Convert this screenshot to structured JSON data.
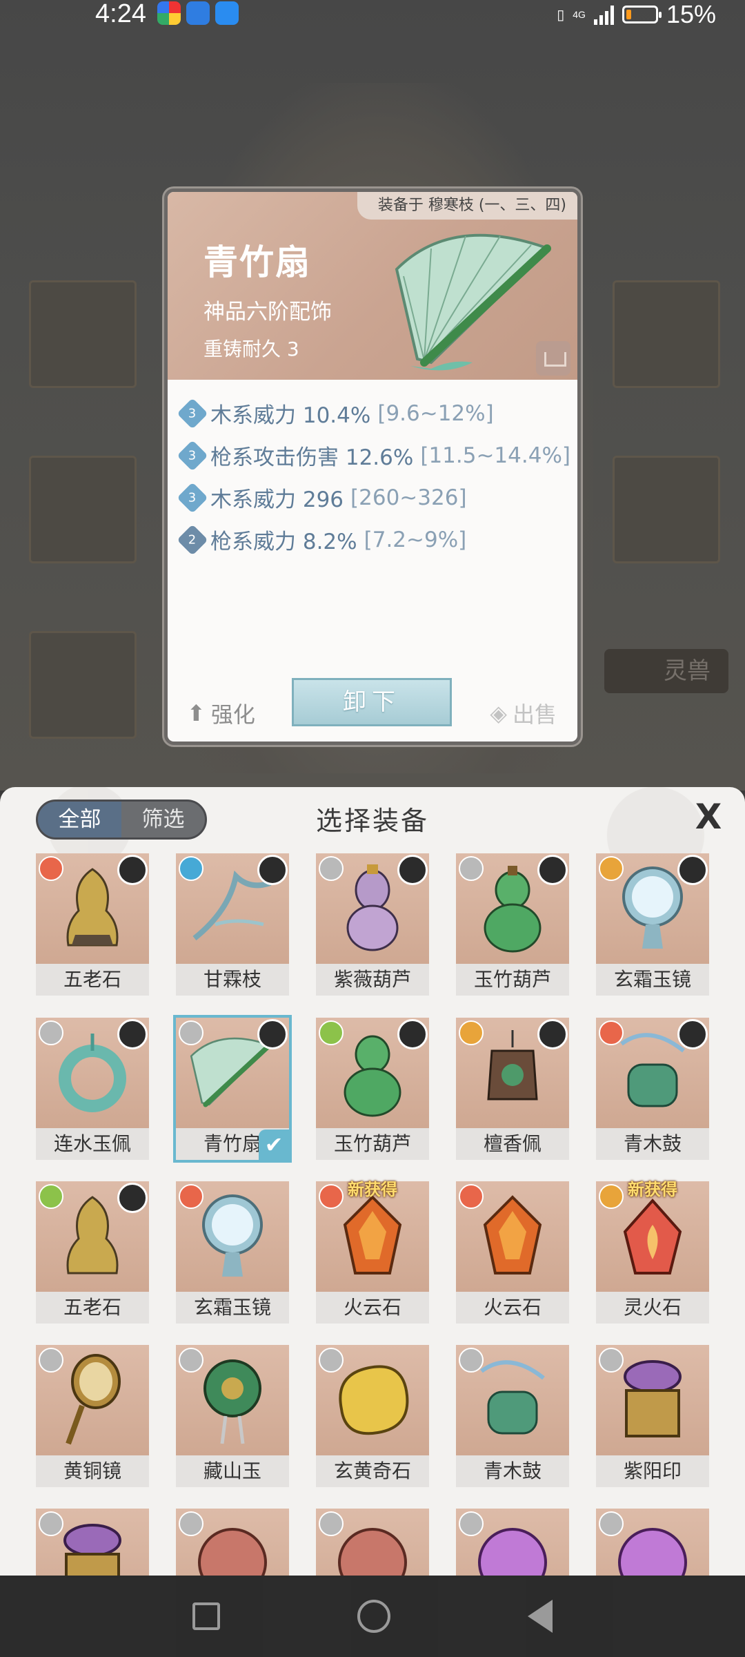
{
  "status_bar": {
    "time": "4:24",
    "network": "4G",
    "battery_pct": "15%",
    "battery_level": 0.15
  },
  "detail": {
    "equipped_on": "装备于 穆寒枝 (一、三、四)",
    "name": "青竹扇",
    "grade": "神品六阶配饰",
    "durability": "重铸耐久 3",
    "stats": [
      {
        "gem": "3",
        "text": "木系威力 10.4%",
        "range": "[9.6~12%]"
      },
      {
        "gem": "3",
        "text": "枪系攻击伤害 12.6%",
        "range": "[11.5~14.4%]"
      },
      {
        "gem": "3",
        "text": "木系威力 296",
        "range": "[260~326]"
      },
      {
        "gem": "2",
        "text": "枪系威力 8.2%",
        "range": "[7.2~9%]"
      }
    ],
    "enhance_label": "强化",
    "unequip_label": "卸下",
    "sell_label": "出售"
  },
  "sheet": {
    "tab_all": "全部",
    "tab_filter": "筛选",
    "title": "选择装备",
    "close": "X",
    "new_badge": "新获得",
    "items": [
      {
        "name": "五老石",
        "elem": "#e8664a",
        "owned": true
      },
      {
        "name": "甘霖枝",
        "elem": "#46a9d6",
        "owned": true
      },
      {
        "name": "紫薇葫芦",
        "elem": "#b9b9b9",
        "owned": true
      },
      {
        "name": "玉竹葫芦",
        "elem": "#b9b9b9",
        "owned": true
      },
      {
        "name": "玄霜玉镜",
        "elem": "#e8a43a",
        "owned": true
      },
      {
        "name": "连水玉佩",
        "elem": "#b9b9b9",
        "owned": true
      },
      {
        "name": "青竹扇",
        "elem": "#b9b9b9",
        "owned": true,
        "selected": true
      },
      {
        "name": "玉竹葫芦",
        "elem": "#8cc24a",
        "owned": true
      },
      {
        "name": "檀香佩",
        "elem": "#e8a43a",
        "owned": true
      },
      {
        "name": "青木鼓",
        "elem": "#e8664a",
        "owned": true
      },
      {
        "name": "五老石",
        "elem": "#8cc24a",
        "owned": true
      },
      {
        "name": "玄霜玉镜",
        "elem": "#e8664a",
        "owned": false
      },
      {
        "name": "火云石",
        "elem": "#e8664a",
        "new": true
      },
      {
        "name": "火云石",
        "elem": "#e8664a",
        "new": false
      },
      {
        "name": "灵火石",
        "elem": "#e8a43a",
        "new": true
      },
      {
        "name": "黄铜镜",
        "elem": "#b9b9b9"
      },
      {
        "name": "藏山玉",
        "elem": "#b9b9b9"
      },
      {
        "name": "玄黄奇石",
        "elem": "#b9b9b9"
      },
      {
        "name": "青木鼓",
        "elem": "#b9b9b9"
      },
      {
        "name": "紫阳印",
        "elem": "#b9b9b9"
      },
      {
        "name": "",
        "elem": "#b9b9b9"
      },
      {
        "name": "",
        "elem": "#b9b9b9"
      },
      {
        "name": "",
        "elem": "#b9b9b9"
      },
      {
        "name": "",
        "elem": "#b9b9b9"
      },
      {
        "name": "",
        "elem": "#b9b9b9"
      }
    ]
  },
  "background": {
    "side_button": "灵兽"
  },
  "nav": {
    "recent": "recent-apps-icon",
    "home": "home-icon",
    "back": "back-icon"
  }
}
